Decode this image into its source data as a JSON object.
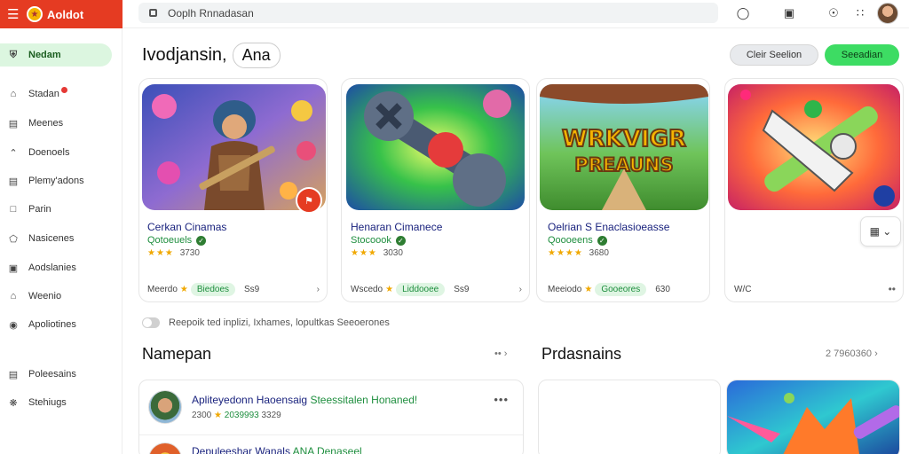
{
  "app": {
    "name": "Aoldot"
  },
  "search": {
    "value": "Ooplh Rnnadasan"
  },
  "sidebar": {
    "items": [
      {
        "label": "Nedam",
        "icon": "shield-icon",
        "active": true
      },
      {
        "label": "Stadan",
        "icon": "home-icon",
        "badge": true
      },
      {
        "label": "Meenes",
        "icon": "list-icon"
      },
      {
        "label": "Doenoels",
        "icon": "tag-icon"
      },
      {
        "label": "Plemy'adons",
        "icon": "doc-icon"
      },
      {
        "label": "Parin",
        "icon": "folder-icon"
      },
      {
        "label": "Nasicenes",
        "icon": "shape-icon"
      },
      {
        "label": "Aodslanies",
        "icon": "archive-icon"
      },
      {
        "label": "Weenio",
        "icon": "home-outline-icon"
      },
      {
        "label": "Apoliotines",
        "icon": "puzzle-icon"
      },
      {
        "label": "Poleesains",
        "icon": "card-icon"
      },
      {
        "label": "Stehiugs",
        "icon": "settings-icon"
      }
    ]
  },
  "header": {
    "title": "Ivodjansin,",
    "chip": "Ana",
    "clear_button": "Cleir Seelion",
    "primary_button": "Seeadian"
  },
  "cards": [
    {
      "title": "Cerkan Cinamas",
      "subtitle": "Qotoeuels",
      "rating_text": "3730",
      "foot_label": "Meerdo",
      "pill": "Biedoes",
      "num": "Ss9"
    },
    {
      "title": "Henaran Cimanece",
      "subtitle": "Stocoook",
      "rating_text": "3030",
      "foot_label": "Wscedo",
      "pill": "Liddooee",
      "num": "Ss9"
    },
    {
      "title": "Oelrian S Enaclasioeasse",
      "subtitle": "Qoooeens",
      "rating_text": "3680",
      "foot_label": "Meeiodo",
      "pill": "Gooeores",
      "num": "630"
    },
    {
      "foot_label": "W/C"
    }
  ],
  "thumb_texts": {
    "card3_line1": "WRKVIGR",
    "card3_line2": "PREAUNS"
  },
  "toggle_label": "Reepoik ted inplizi, Ixhames, lopultkas Seeoerones",
  "sections": {
    "left": {
      "title": "Namepan",
      "rows": [
        {
          "title": "Apliteyedonn Haoensaig",
          "title_green": "Steessitalen Honaned!",
          "meta": "2300",
          "meta_green": "2039993",
          "meta2": "3329"
        },
        {
          "title": "Depuleeshar Wanals",
          "title_green": "ANA Denaseel"
        }
      ]
    },
    "right": {
      "title": "Prdasnains",
      "meta": "2 7960360"
    }
  }
}
